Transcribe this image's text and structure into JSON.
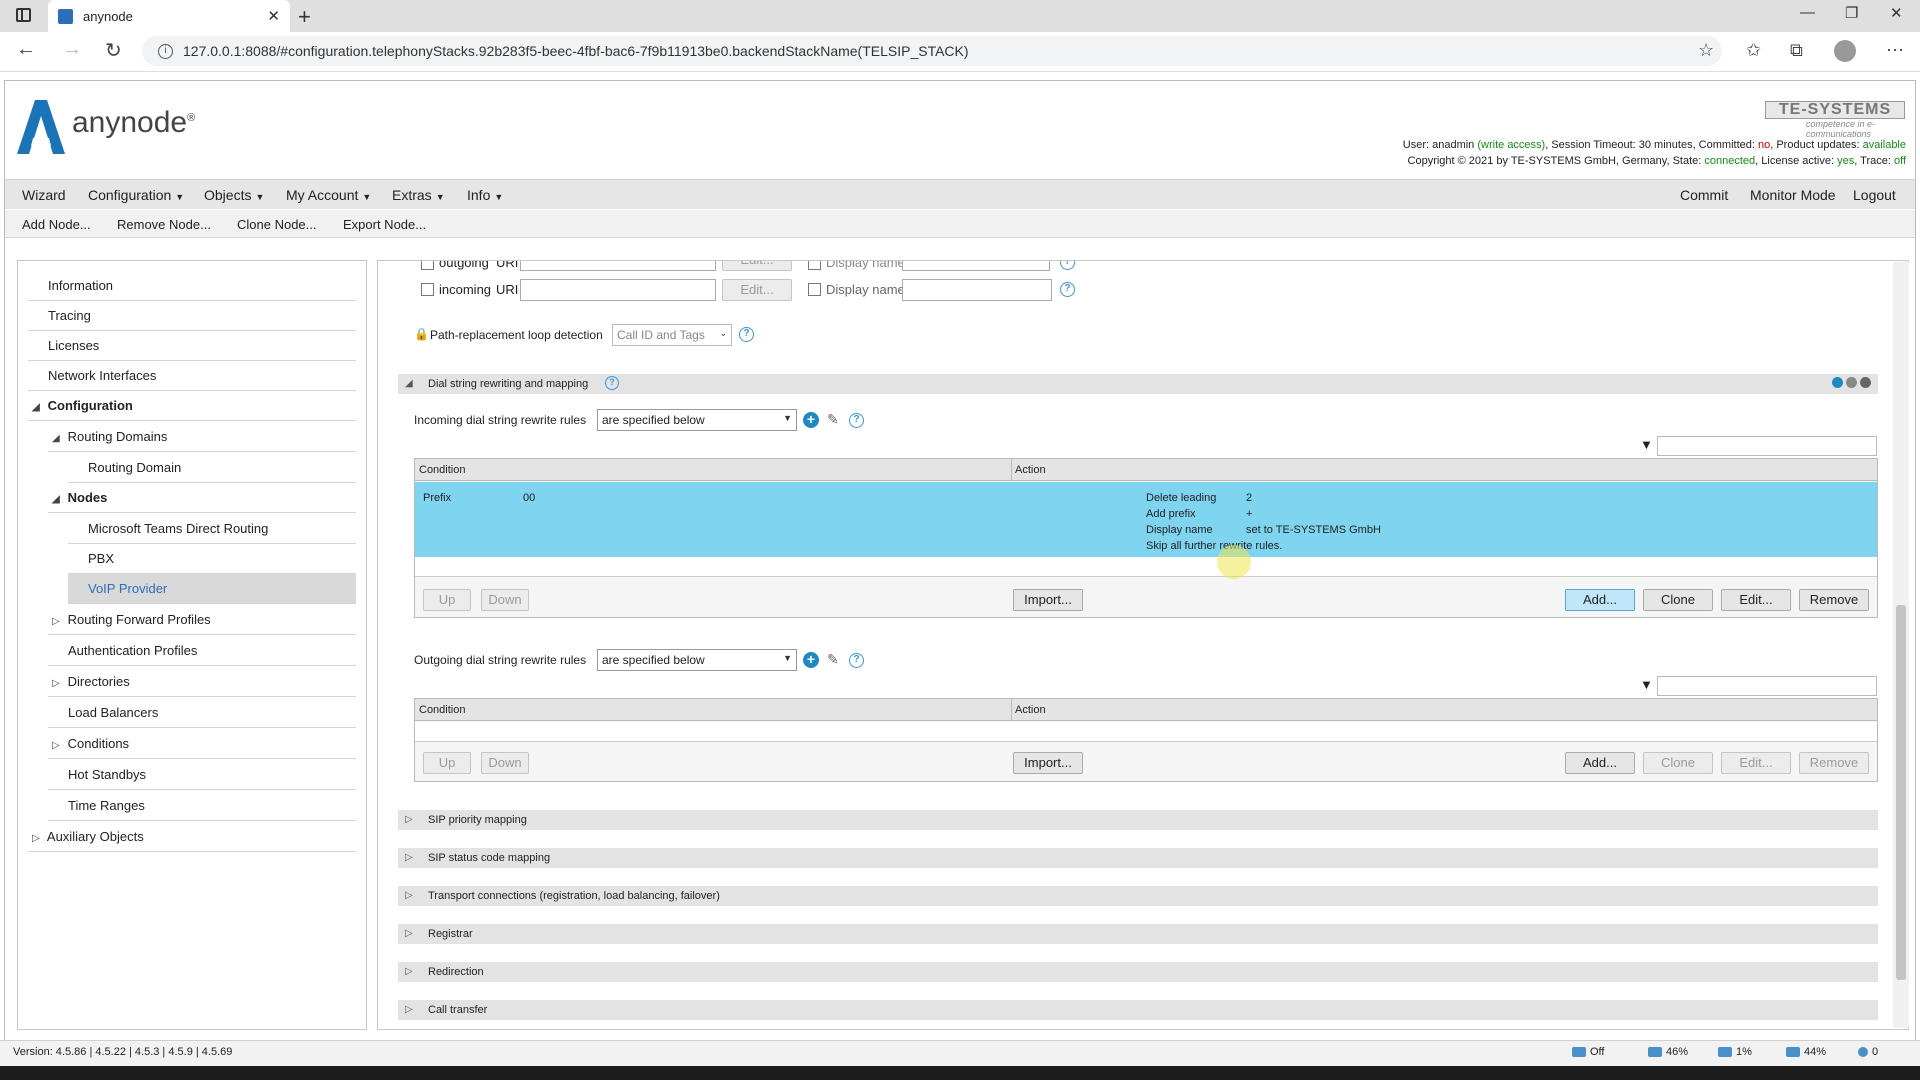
{
  "browser": {
    "tab_title": "anynode",
    "url": "127.0.0.1:8088/#configuration.telephonyStacks.92b283f5-beec-4fbf-bac6-7f9b11913be0.backendStackName(TELSIP_STACK)"
  },
  "header": {
    "logo_text": "anynode",
    "logo_reg": "®",
    "brand": "TE-SYSTEMS",
    "brand_sub": "competence in e-communications",
    "user_label": "User: ",
    "user": "anadmin",
    "user_access": "(write access)",
    "session": ", Session Timeout: 30 minutes, Committed: ",
    "committed": "no",
    "updates_label": ", Product updates: ",
    "updates": "available",
    "copyright": "Copyright © 2021 by TE-SYSTEMS GmbH, Germany, State: ",
    "state": "connected",
    "license_label": ", License active: ",
    "license": "yes",
    "trace_label": ", Trace: ",
    "trace": "off"
  },
  "menu": {
    "wizard": "Wizard",
    "configuration": "Configuration",
    "objects": "Objects",
    "my_account": "My Account",
    "extras": "Extras",
    "info": "Info",
    "commit": "Commit",
    "monitor_mode": "Monitor Mode",
    "logout": "Logout"
  },
  "toolbar": {
    "add_node": "Add Node...",
    "remove_node": "Remove Node...",
    "clone_node": "Clone Node...",
    "export_node": "Export Node..."
  },
  "tree": {
    "information": "Information",
    "tracing": "Tracing",
    "licenses": "Licenses",
    "network_interfaces": "Network Interfaces",
    "configuration": "Configuration",
    "routing_domains": "Routing Domains",
    "routing_domain": "Routing Domain",
    "nodes": "Nodes",
    "ms_teams": "Microsoft Teams Direct Routing",
    "pbx": "PBX",
    "voip_provider": "VoIP Provider",
    "routing_forward_profiles": "Routing Forward Profiles",
    "authentication_profiles": "Authentication Profiles",
    "directories": "Directories",
    "load_balancers": "Load Balancers",
    "conditions": "Conditions",
    "hot_standbys": "Hot Standbys",
    "time_ranges": "Time Ranges",
    "auxiliary_objects": "Auxiliary Objects"
  },
  "main": {
    "outgoing_label": "outgoing",
    "uri_label": "URI",
    "edit_label": "Edit...",
    "display_name_label": "Display name",
    "incoming_label": "incoming",
    "loop_detection_label": "Path-replacement loop detection",
    "loop_detection_value": "Call ID and Tags",
    "dial_section_title": "Dial string rewriting and mapping",
    "incoming_rules_label": "Incoming dial string rewrite rules",
    "incoming_rules_value": "are specified below",
    "outgoing_rules_label": "Outgoing dial string rewrite rules",
    "outgoing_rules_value": "are specified below",
    "col_condition": "Condition",
    "col_action": "Action",
    "incoming_rows": [
      {
        "cond_type": "Prefix",
        "cond_value": "00",
        "actions": [
          {
            "key": "Delete leading",
            "value": "2"
          },
          {
            "key": "Add prefix",
            "value": "+"
          },
          {
            "key": "Display name",
            "value": "set to TE-SYSTEMS GmbH"
          },
          {
            "key": "Skip all further rewrite rules.",
            "value": ""
          }
        ]
      }
    ],
    "btn_up": "Up",
    "btn_down": "Down",
    "btn_import": "Import...",
    "btn_add": "Add...",
    "btn_clone": "Clone",
    "btn_edit": "Edit...",
    "btn_remove": "Remove",
    "sections": [
      "SIP priority mapping",
      "SIP status code mapping",
      "Transport connections (registration, load balancing, failover)",
      "Registrar",
      "Redirection",
      "Call transfer"
    ]
  },
  "status": {
    "version": "Version: 4.5.86 | 4.5.22 | 4.5.3 | 4.5.9 | 4.5.69",
    "net": "Off",
    "disk": "46%",
    "cpu": "1%",
    "mem": "44%",
    "alerts": "0"
  }
}
